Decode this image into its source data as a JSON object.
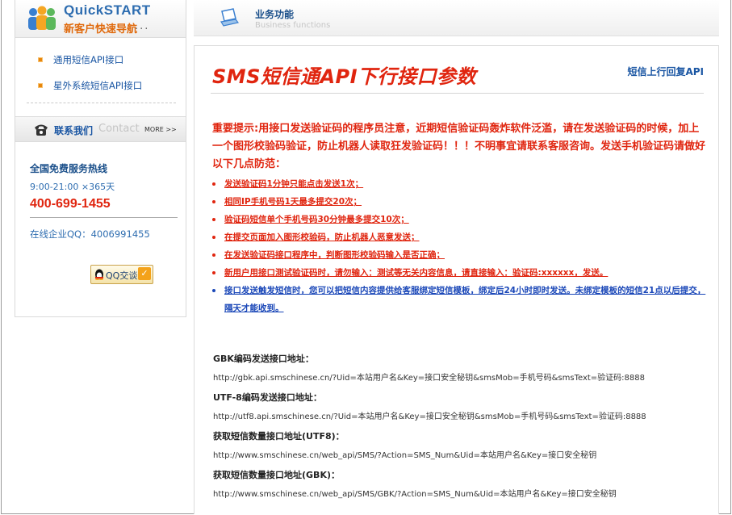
{
  "sidebar": {
    "quickstart": {
      "title": "QuickSTART",
      "subtitle": "新客户快速导航",
      "dots": "..."
    },
    "menu": [
      {
        "label": "通用短信API接口"
      },
      {
        "label": "星外系统短信API接口"
      }
    ],
    "contact": {
      "title_cn": "联系我们",
      "title_en": "Contact",
      "more": "MORE >>"
    },
    "hotline": {
      "title": "全国免费服务热线",
      "hours": "9:00-21:00 ×365天",
      "phone": "400-699-1455",
      "qq": "在线企业QQ：4006991455"
    },
    "qq_button": {
      "label": "QQ交谈",
      "check": "✓"
    }
  },
  "header": {
    "title_cn": "业务功能",
    "title_en": "Business functions"
  },
  "main": {
    "title": "SMS短信通API下行接口参数",
    "link": "短信上行回复API",
    "notice": "重要提示:用接口发送验证码的程序员注意，近期短信验证码轰炸软件泛滥，请在发送验证码的时候，加上一个图形校验码验证，防止机器人读取狂发验证码！！！不明事宜请联系客服咨询。发送手机验证码请做好以下几点防范：",
    "tips": [
      {
        "text": "发送验证码1分钟只能点击发送1次；",
        "color": "red"
      },
      {
        "text": "相同IP手机号码1天最多提交20次；",
        "color": "red"
      },
      {
        "text": "验证码短信单个手机号码30分钟最多提交10次；",
        "color": "red"
      },
      {
        "text": "在提交页面加入图形校验码，防止机器人恶意发送；",
        "color": "red"
      },
      {
        "text": "在发送验证码接口程序中，判断图形校验码输入是否正确；",
        "color": "red"
      },
      {
        "text": "新用户用接口测试验证码时，请勿输入：测试等无关内容信息，请直接输入：验证码:xxxxxx，发送。",
        "color": "red"
      },
      {
        "text": "接口发送触发短信时，您可以把短信内容提供给客服绑定短信模板，绑定后24小时即时发送。未绑定模板的短信21点以后提交，隔天才能收到。",
        "color": "blue"
      }
    ],
    "api": [
      {
        "label": "GBK编码发送接口地址：",
        "url": "http://gbk.api.smschinese.cn/?Uid=本站用户名&Key=接口安全秘钥&smsMob=手机号码&smsText=验证码:8888"
      },
      {
        "label": "UTF-8编码发送接口地址：",
        "url": "http://utf8.api.smschinese.cn/?Uid=本站用户名&Key=接口安全秘钥&smsMob=手机号码&smsText=验证码:8888"
      },
      {
        "label": "获取短信数量接口地址(UTF8)：",
        "url": "http://www.smschinese.cn/web_api/SMS/?Action=SMS_Num&Uid=本站用户名&Key=接口安全秘钥"
      },
      {
        "label": "获取短信数量接口地址(GBK)：",
        "url": "http://www.smschinese.cn/web_api/SMS/GBK/?Action=SMS_Num&Uid=本站用户名&Key=接口安全秘钥"
      }
    ]
  },
  "colors": {
    "accent_red": "#e0250f",
    "link_blue": "#1a56a3",
    "tip_blue": "#1a47b8",
    "orange": "#e06a0d"
  }
}
